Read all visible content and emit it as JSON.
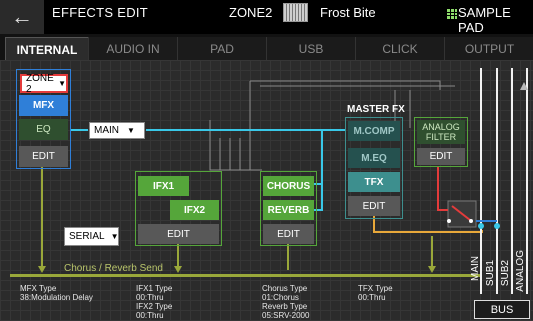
{
  "header": {
    "title": "EFFECTS EDIT",
    "zone": "ZONE2",
    "tone_name": "Frost Bite",
    "sample_pad": "SAMPLE PAD"
  },
  "tabs": [
    {
      "label": "INTERNAL",
      "active": true
    },
    {
      "label": "AUDIO IN",
      "active": false
    },
    {
      "label": "PAD",
      "active": false
    },
    {
      "label": "USB",
      "active": false
    },
    {
      "label": "CLICK",
      "active": false
    },
    {
      "label": "OUTPUT",
      "active": false
    }
  ],
  "zone_block": {
    "zone_select": "ZONE 2",
    "mfx": "MFX",
    "eq": "EQ",
    "edit": "EDIT"
  },
  "main_select": "MAIN",
  "ifx": {
    "ifx1": "IFX1",
    "ifx2": "IFX2",
    "edit": "EDIT",
    "mode_select": "SERIAL"
  },
  "cr_block": {
    "chorus": "CHORUS",
    "reverb": "REVERB",
    "edit": "EDIT"
  },
  "master_fx": {
    "title": "MASTER FX",
    "mcomp": "M.COMP",
    "meq": "M.EQ",
    "tfx": "TFX",
    "edit": "EDIT"
  },
  "analog_filter": {
    "label_line1": "ANALOG",
    "label_line2": "FILTER",
    "edit": "EDIT"
  },
  "send_label": "Chorus / Reverb Send",
  "info": {
    "mfx_type_label": "MFX Type",
    "mfx_type_value": "38:Modulation Delay",
    "ifx1_type_label": "IFX1 Type",
    "ifx1_type_value": "00:Thru",
    "ifx2_type_label": "IFX2 Type",
    "ifx2_type_value": "00:Thru",
    "chorus_type_label": "Chorus Type",
    "chorus_type_value": "01:Chorus",
    "reverb_type_label": "Reverb Type",
    "reverb_type_value": "05:SRV-2000",
    "tfx_type_label": "TFX Type",
    "tfx_type_value": "00:Thru"
  },
  "outputs": [
    "MAIN",
    "SUB1",
    "SUB2",
    "ANALOG"
  ],
  "bus_label": "BUS",
  "colors": {
    "zone_border": "#2f7fd8",
    "green": "#55a63a",
    "cyan_line": "#39c8e8",
    "orange_line": "#e8a83a",
    "send_bar": "#9aa83a",
    "teal": "#3d8f8e"
  },
  "icons": {
    "back": "back-arrow-icon",
    "keyboard": "keyboard-icon",
    "sample_pad": "grid-icon"
  }
}
